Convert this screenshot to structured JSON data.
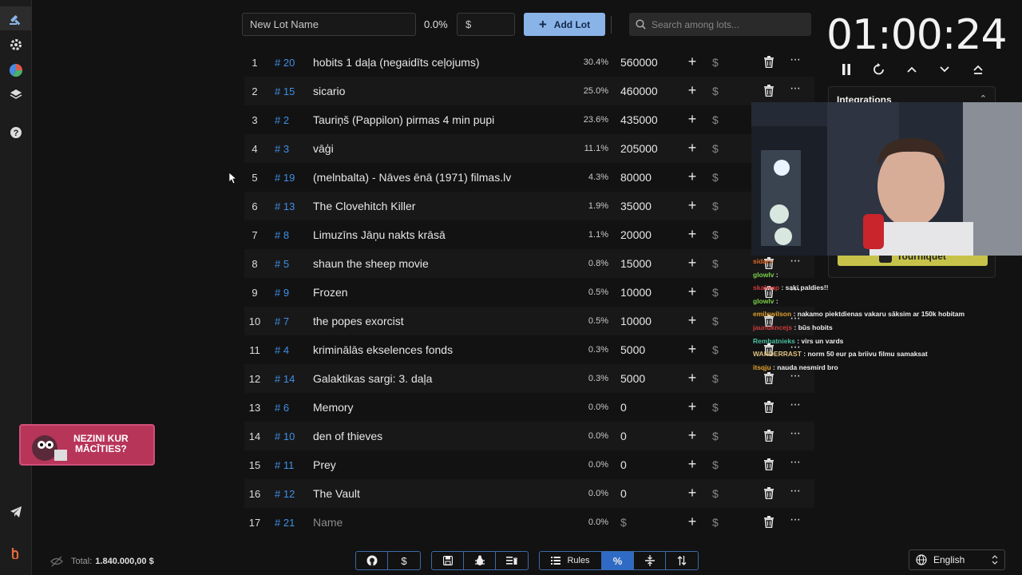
{
  "toolbar": {
    "lot_name_placeholder": "New Lot Name",
    "percent": "0.0%",
    "amount_placeholder": "$",
    "add_lot_label": "Add Lot",
    "search_placeholder": "Search among lots..."
  },
  "lots": [
    {
      "index": "1",
      "id": "# 20",
      "name": "hobits 1 daļa (negaidīts ceļojums)",
      "percent": "30.4%",
      "amount": "560000"
    },
    {
      "index": "2",
      "id": "# 15",
      "name": "sicario",
      "percent": "25.0%",
      "amount": "460000"
    },
    {
      "index": "3",
      "id": "# 2",
      "name": "Tauriņš (Pappilon) pirmas 4 min pupi",
      "percent": "23.6%",
      "amount": "435000"
    },
    {
      "index": "4",
      "id": "# 3",
      "name": "vāģi",
      "percent": "11.1%",
      "amount": "205000"
    },
    {
      "index": "5",
      "id": "# 19",
      "name": "(melnbalta) - Nāves ēnā (1971) filmas.lv",
      "percent": "4.3%",
      "amount": "80000"
    },
    {
      "index": "6",
      "id": "# 13",
      "name": "The Clovehitch Killer",
      "percent": "1.9%",
      "amount": "35000"
    },
    {
      "index": "7",
      "id": "# 8",
      "name": "Limuzīns Jāņu nakts krāsā",
      "percent": "1.1%",
      "amount": "20000"
    },
    {
      "index": "8",
      "id": "# 5",
      "name": "shaun the sheep movie",
      "percent": "0.8%",
      "amount": "15000"
    },
    {
      "index": "9",
      "id": "# 9",
      "name": "Frozen",
      "percent": "0.5%",
      "amount": "10000"
    },
    {
      "index": "10",
      "id": "# 7",
      "name": "the popes exorcist",
      "percent": "0.5%",
      "amount": "10000"
    },
    {
      "index": "11",
      "id": "# 4",
      "name": "kriminālās ekselences fonds",
      "percent": "0.3%",
      "amount": "5000"
    },
    {
      "index": "12",
      "id": "# 14",
      "name": "Galaktikas sargi: 3. daļa",
      "percent": "0.3%",
      "amount": "5000"
    },
    {
      "index": "13",
      "id": "# 6",
      "name": "Memory",
      "percent": "0.0%",
      "amount": "0"
    },
    {
      "index": "14",
      "id": "# 10",
      "name": "den of thieves",
      "percent": "0.0%",
      "amount": "0"
    },
    {
      "index": "15",
      "id": "# 11",
      "name": "Prey",
      "percent": "0.0%",
      "amount": "0"
    },
    {
      "index": "16",
      "id": "# 12",
      "name": "The Vault",
      "percent": "0.0%",
      "amount": "0"
    },
    {
      "index": "17",
      "id": "# 21",
      "name": "Name",
      "percent": "0.0%",
      "amount": "$",
      "placeholder": true
    }
  ],
  "row_buttons": {
    "plus": "+",
    "dollar": "$",
    "more": "···"
  },
  "timer": {
    "value": "01:00:24"
  },
  "integrations": {
    "title": "Integrations",
    "tourniquet_label": "Tourniquet"
  },
  "chat": [
    {
      "user": "sidars",
      "text": "",
      "color": "#e06a2a"
    },
    {
      "user": "glowlv",
      "text": ":",
      "color": "#7ad04a"
    },
    {
      "user": "skalwap",
      "text": ": saki paldies!!",
      "color": "#d03a3a"
    },
    {
      "user": "glowlv",
      "text": ":",
      "color": "#7ad04a"
    },
    {
      "user": "emilswilson",
      "text": ": nakamo piektdienas vakaru sāksim ar 150k hobitam",
      "color": "#e0a02a"
    },
    {
      "user": "jaunukncejs",
      "text": ": būs hobits",
      "color": "#d03a3a"
    },
    {
      "user": "Rembatnieks",
      "text": ": virs un vards",
      "color": "#4ac0a0"
    },
    {
      "user": "WANDERRAST",
      "text": ": norm 50 eur pa briivu filmu samaksat",
      "color": "#e0c080"
    },
    {
      "user": "itsqju",
      "text": ": nauda nesmird bro",
      "color": "#e0a02a"
    }
  ],
  "footer": {
    "total_label": "Total:",
    "total_value": "1.840.000,00 $",
    "rules_label": "Rules",
    "language": "English"
  },
  "promo": {
    "line1": "NEZINI KUR",
    "line2": "MĀCĪTIES?"
  },
  "colors": {
    "accent": "#8ab4e8",
    "link_blue": "#3f8fe6",
    "active_button": "#2f6bc4",
    "tourniquet": "#c7c34a",
    "promo": "#b8355a"
  }
}
